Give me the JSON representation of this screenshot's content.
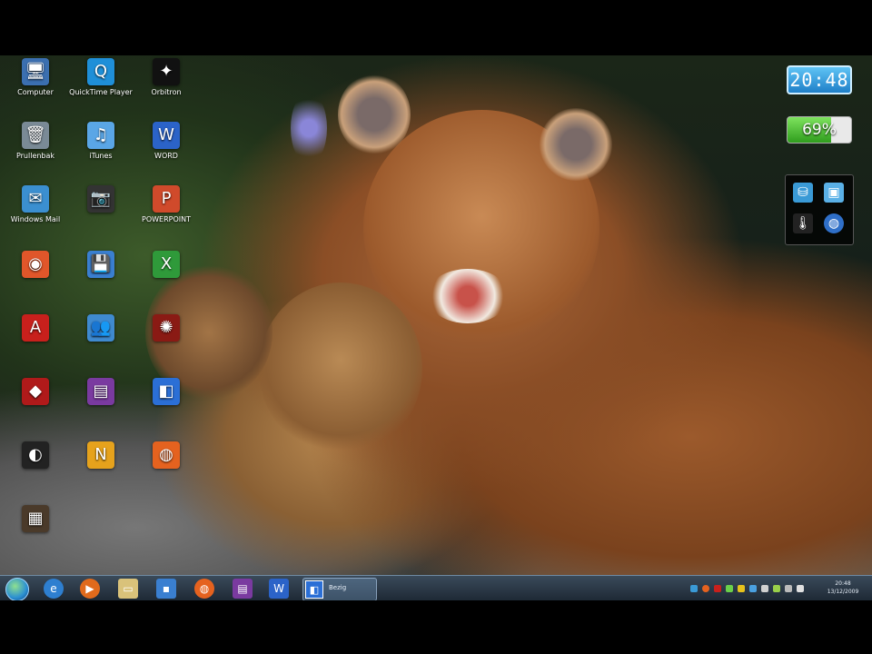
{
  "desktop": {
    "icons": [
      {
        "label": "Computer",
        "icon": "computer-icon",
        "color": "#3b6fb0",
        "glyph": "🖥"
      },
      {
        "label": "QuickTime Player",
        "icon": "quicktime-icon",
        "color": "#1f8fd8",
        "glyph": "Q"
      },
      {
        "label": "Orbitron",
        "icon": "orbitron-icon",
        "color": "#111111",
        "glyph": "✦"
      },
      {
        "label": "Prullenbak",
        "icon": "recycle-bin-icon",
        "color": "#7a8a96",
        "glyph": "🗑"
      },
      {
        "label": "iTunes",
        "icon": "itunes-icon",
        "color": "#5aa6e6",
        "glyph": "♫"
      },
      {
        "label": "WORD",
        "icon": "word-icon",
        "color": "#2b63c8",
        "glyph": "W"
      },
      {
        "label": "Windows Mail",
        "icon": "windows-mail-icon",
        "color": "#3b8fd0",
        "glyph": "✉"
      },
      {
        "label": "",
        "icon": "camera-icon",
        "color": "#333333",
        "glyph": "📷"
      },
      {
        "label": "POWERPOINT",
        "icon": "powerpoint-icon",
        "color": "#d04a2b",
        "glyph": "P"
      },
      {
        "label": "",
        "icon": "photo-camera-icon",
        "color": "#e0562a",
        "glyph": "◉"
      },
      {
        "label": "",
        "icon": "floppy-disk-icon",
        "color": "#3a7fd0",
        "glyph": "💾"
      },
      {
        "label": "",
        "icon": "excel-icon",
        "color": "#2f9a3a",
        "glyph": "X"
      },
      {
        "label": "",
        "icon": "pdf-icon",
        "color": "#c8201c",
        "glyph": "A"
      },
      {
        "label": "",
        "icon": "users-icon",
        "color": "#3f8ad0",
        "glyph": "👥"
      },
      {
        "label": "",
        "icon": "game-icon",
        "color": "#8a1a14",
        "glyph": "✺"
      },
      {
        "label": "",
        "icon": "red-app-icon",
        "color": "#b01a1a",
        "glyph": "◆"
      },
      {
        "label": "",
        "icon": "winrar-icon",
        "color": "#7a3aa0",
        "glyph": "▤"
      },
      {
        "label": "",
        "icon": "blue-app-icon",
        "color": "#2b6fd6",
        "glyph": "◧"
      },
      {
        "label": "",
        "icon": "dark-app-icon",
        "color": "#222222",
        "glyph": "◐"
      },
      {
        "label": "",
        "icon": "norton-icon",
        "color": "#e6a21c",
        "glyph": "N"
      },
      {
        "label": "",
        "icon": "firefox-icon",
        "color": "#e5621f",
        "glyph": "◍"
      },
      {
        "label": "",
        "icon": "film-icon",
        "color": "#4a3a2a",
        "glyph": "▦"
      }
    ]
  },
  "gadgets": {
    "clock_time": "20:48",
    "battery_percent": "69%",
    "battery_level": 0.69,
    "panel_icons": [
      "network-icon",
      "control-icon",
      "thermometer-icon",
      "globe-icon"
    ]
  },
  "taskbar": {
    "pinned": [
      "ie-icon",
      "media-player-icon",
      "windows-explorer-icon",
      "floppy-disk-icon",
      "firefox-icon",
      "winrar-icon",
      "word-icon"
    ],
    "active_task_label": "Bezig",
    "tray_time": "20:48",
    "tray_date": "13/12/2009"
  },
  "colors": {
    "taskbar": "#1d2834",
    "clock_bg": "#1f7fc8",
    "battery_fill": "#2f9d1d"
  }
}
